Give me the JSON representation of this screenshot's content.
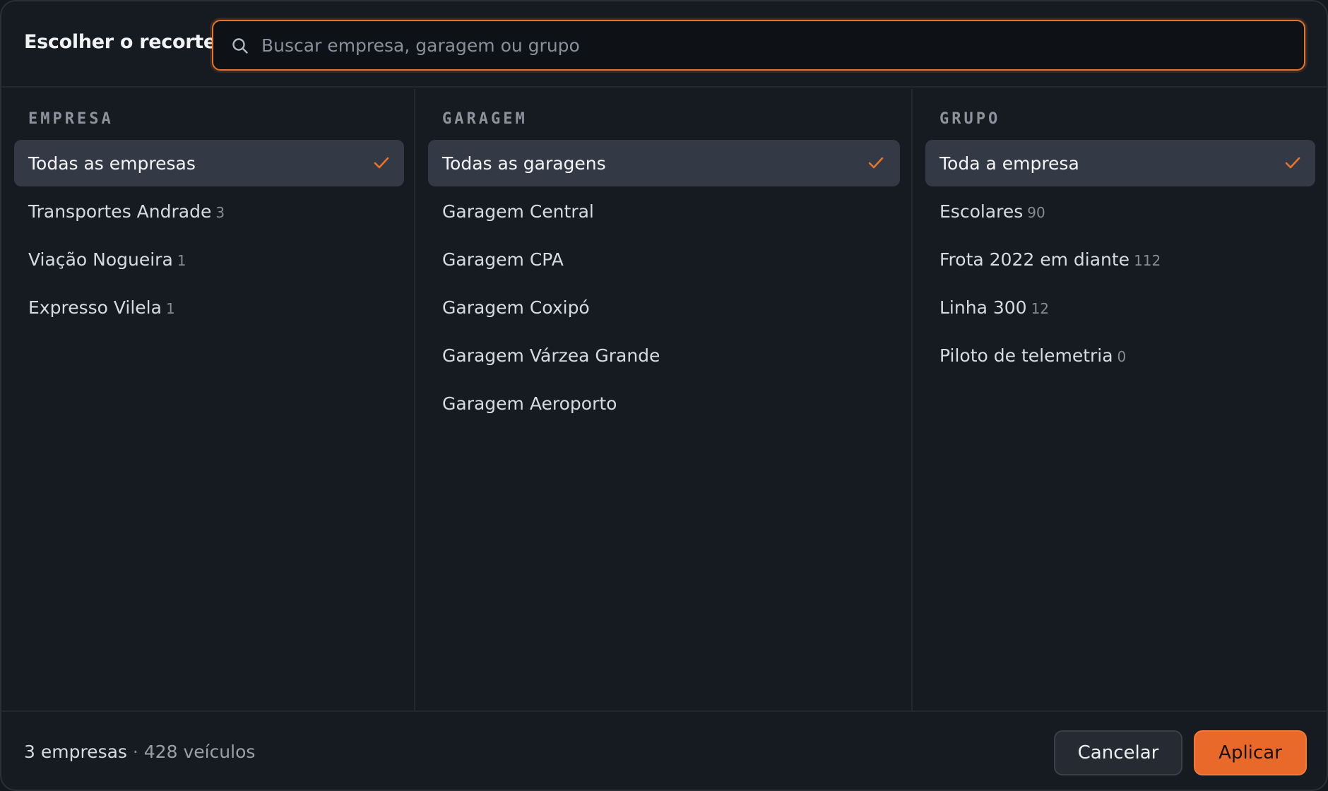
{
  "dialog": {
    "title": "Escolher o recorte"
  },
  "search": {
    "placeholder": "Buscar empresa, garagem ou grupo",
    "value": ""
  },
  "columns": {
    "empresa": {
      "heading": "EMPRESA",
      "items": [
        {
          "label": "Todas as empresas",
          "count": "",
          "selected": true
        },
        {
          "label": "Transportes Andrade",
          "count": "3",
          "selected": false
        },
        {
          "label": "Viação Nogueira",
          "count": "1",
          "selected": false
        },
        {
          "label": "Expresso Vilela",
          "count": "1",
          "selected": false
        }
      ]
    },
    "garagem": {
      "heading": "GARAGEM",
      "items": [
        {
          "label": "Todas as garagens",
          "count": "",
          "selected": true
        },
        {
          "label": "Garagem Central",
          "count": "",
          "selected": false
        },
        {
          "label": "Garagem CPA",
          "count": "",
          "selected": false
        },
        {
          "label": "Garagem Coxipó",
          "count": "",
          "selected": false
        },
        {
          "label": "Garagem Várzea Grande",
          "count": "",
          "selected": false
        },
        {
          "label": "Garagem Aeroporto",
          "count": "",
          "selected": false
        }
      ]
    },
    "grupo": {
      "heading": "GRUPO",
      "items": [
        {
          "label": "Toda a empresa",
          "count": "",
          "selected": true
        },
        {
          "label": "Escolares",
          "count": "90",
          "selected": false
        },
        {
          "label": "Frota 2022 em diante",
          "count": "112",
          "selected": false
        },
        {
          "label": "Linha 300",
          "count": "12",
          "selected": false
        },
        {
          "label": "Piloto de telemetria",
          "count": "0",
          "selected": false
        }
      ]
    }
  },
  "footer": {
    "summary_companies": "3 empresas",
    "summary_separator": " · ",
    "summary_vehicles": "428 veículos",
    "cancel_label": "Cancelar",
    "apply_label": "Aplicar"
  },
  "colors": {
    "accent": "#e8692a",
    "check": "#e8742b",
    "selected_bg": "#343a45",
    "background": "#161a21"
  },
  "icons": {
    "search": "search-icon",
    "check": "check-icon"
  }
}
